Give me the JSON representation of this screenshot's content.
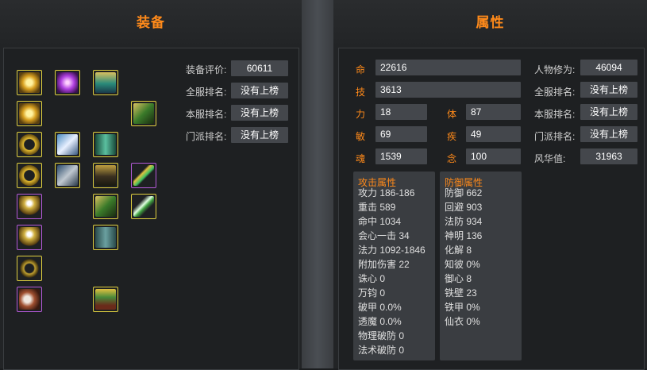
{
  "equipment": {
    "title": "装备",
    "slots": [
      {
        "icon": "sun-ring-icon",
        "rarity": "gold"
      },
      {
        "icon": "purple-orb-icon",
        "rarity": "gold"
      },
      {
        "icon": "jade-helmet-icon",
        "rarity": "gold"
      },
      {
        "icon": "sun-ring-icon",
        "rarity": "gold"
      },
      {
        "icon": "green-armor-icon",
        "rarity": "gold"
      },
      {
        "icon": "gold-bracelet-icon",
        "rarity": "gold"
      },
      {
        "icon": "feather-icon",
        "rarity": "gold"
      },
      {
        "icon": "green-robe-icon",
        "rarity": "gold"
      },
      {
        "icon": "gold-bracelet-icon",
        "rarity": "gold"
      },
      {
        "icon": "gauntlet-icon",
        "rarity": "gold"
      },
      {
        "icon": "chest-armor-icon",
        "rarity": "gold"
      },
      {
        "icon": "jade-staff-icon",
        "rarity": "purple"
      },
      {
        "icon": "pearl-ring-icon",
        "rarity": "purple"
      },
      {
        "icon": "green-armor-icon",
        "rarity": "gold"
      },
      {
        "icon": "green-blade-icon",
        "rarity": "gold"
      },
      {
        "icon": "pearl-ring-icon",
        "rarity": "purple"
      },
      {
        "icon": "trousers-icon",
        "rarity": "gold"
      },
      {
        "icon": "necklace-icon",
        "rarity": "gold"
      },
      {
        "icon": "cloud-charm-icon",
        "rarity": "purple"
      },
      {
        "icon": "warrior-figure-icon",
        "rarity": "gold"
      }
    ],
    "stats": [
      {
        "label": "装备评价:",
        "value": "60611"
      },
      {
        "label": "全服排名:",
        "value": "没有上榜"
      },
      {
        "label": "本服排名:",
        "value": "没有上榜"
      },
      {
        "label": "门派排名:",
        "value": "没有上榜"
      }
    ]
  },
  "attributes": {
    "title": "属性",
    "base": [
      {
        "name": "命",
        "value": "22616"
      },
      {
        "name": "技",
        "value": "3613"
      },
      {
        "name": "力",
        "value": "18"
      },
      {
        "name": "体",
        "value": "87"
      },
      {
        "name": "敏",
        "value": "69"
      },
      {
        "name": "疾",
        "value": "49"
      },
      {
        "name": "魂",
        "value": "1539"
      },
      {
        "name": "念",
        "value": "100"
      }
    ],
    "ranks": [
      {
        "label": "人物修为:",
        "value": "46094"
      },
      {
        "label": "全服排名:",
        "value": "没有上榜"
      },
      {
        "label": "本服排名:",
        "value": "没有上榜"
      },
      {
        "label": "门派排名:",
        "value": "没有上榜"
      },
      {
        "label": "风华值:",
        "value": "31963"
      }
    ],
    "attack": {
      "title": "攻击属性",
      "rows": [
        "攻力 186-186",
        "重击 589",
        "命中 1034",
        "会心一击 34",
        "法力 1092-1846",
        "附加伤害 22",
        "诛心 0",
        "万钧 0",
        "破甲 0.0%",
        "透魔 0.0%",
        "物理破防 0",
        "法术破防 0"
      ]
    },
    "defense": {
      "title": "防御属性",
      "rows": [
        "防御 662",
        "回避 903",
        "法防 934",
        "神明 136",
        "化解 8",
        "知彼 0%",
        "御心 8",
        "铁壁 23",
        "铁甲 0%",
        "仙衣 0%"
      ]
    }
  },
  "colors": {
    "accent": "#ff8a1a",
    "gold_border": "#e0d040",
    "purple_border": "#b45ad8"
  }
}
